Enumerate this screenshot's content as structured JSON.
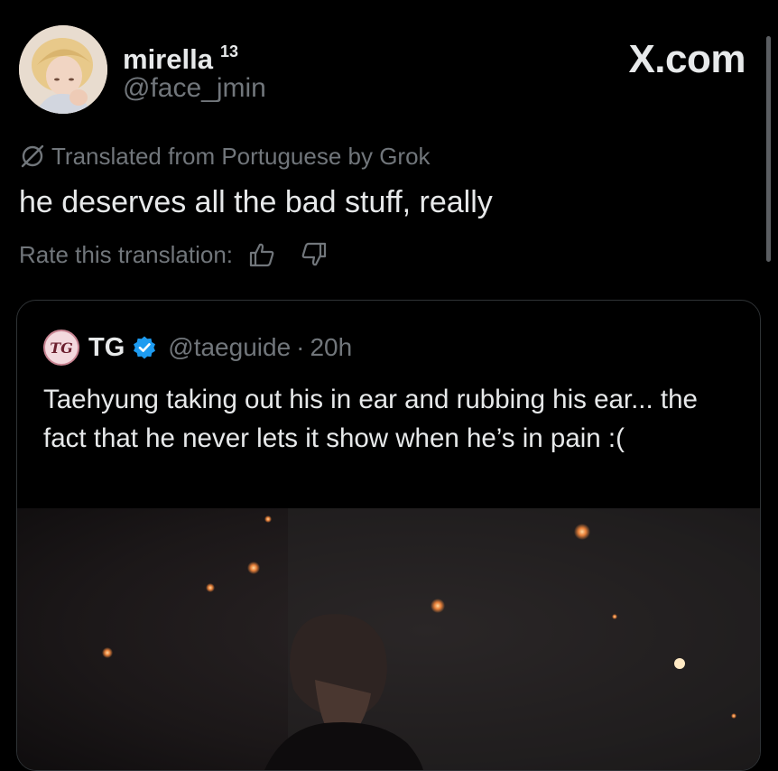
{
  "author": {
    "display_name": "mirella",
    "badge": "13",
    "handle": "@face_jmin",
    "avatar_icon": "profile-photo"
  },
  "header": {
    "site_logo": "X.com"
  },
  "translation": {
    "notice": "Translated from Portuguese by Grok",
    "text": "he deserves all the bad stuff, really",
    "rate_label": "Rate this translation:",
    "thumbs_up_icon": "thumbs-up-icon",
    "thumbs_down_icon": "thumbs-down-icon"
  },
  "quote": {
    "avatar_text": "TG",
    "name": "TG",
    "verified_color": "#1d9bf0",
    "handle": "@taeguide",
    "separator": "·",
    "time": "20h",
    "text": "Taehyung taking out his in ear and rubbing his ear... the fact that he never lets it show when he’s in pain :(",
    "media": "concert-photo"
  },
  "colors": {
    "background": "#000000",
    "text_primary": "#e7e9ea",
    "text_secondary": "#71767b",
    "border": "#2f3336",
    "verified": "#1d9bf0"
  }
}
